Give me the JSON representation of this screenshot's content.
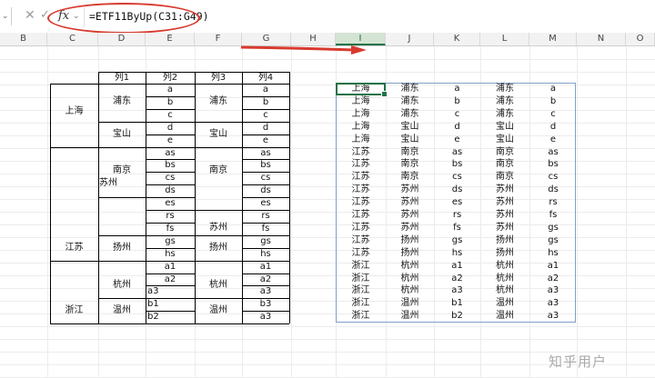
{
  "formula_bar": {
    "function_icon": "fx",
    "formula": "=ETF11ByUp(C31:G49)"
  },
  "columns": [
    "B",
    "C",
    "D",
    "E",
    "F",
    "G",
    "H",
    "I",
    "J",
    "K",
    "L",
    "M",
    "N",
    "O"
  ],
  "selected_column": "I",
  "source": {
    "headers": [
      "列1",
      "列2",
      "列3",
      "列4"
    ],
    "col_c": [
      "上海",
      "江苏",
      "浙江"
    ],
    "col_d": [
      "浦东",
      "宝山",
      "南京",
      "苏州",
      "扬州",
      "杭州",
      "温州"
    ],
    "col_e": [
      "a",
      "b",
      "c",
      "d",
      "e",
      "as",
      "bs",
      "cs",
      "ds",
      "es",
      "rs",
      "fs",
      "gs",
      "hs",
      "a1",
      "a2",
      "a3",
      "b1",
      "b2"
    ],
    "col_f": [
      "浦东",
      "宝山",
      "南京",
      "苏州",
      "扬州",
      "杭州",
      "温州"
    ],
    "col_g": [
      "a",
      "b",
      "c",
      "d",
      "e",
      "as",
      "bs",
      "cs",
      "ds",
      "es",
      "rs",
      "fs",
      "gs",
      "hs",
      "a1",
      "a2",
      "a3",
      "b3",
      "a3"
    ]
  },
  "result": [
    [
      "上海",
      "浦东",
      "a",
      "浦东",
      "a"
    ],
    [
      "上海",
      "浦东",
      "b",
      "浦东",
      "b"
    ],
    [
      "上海",
      "浦东",
      "c",
      "浦东",
      "c"
    ],
    [
      "上海",
      "宝山",
      "d",
      "宝山",
      "d"
    ],
    [
      "上海",
      "宝山",
      "e",
      "宝山",
      "e"
    ],
    [
      "江苏",
      "南京",
      "as",
      "南京",
      "as"
    ],
    [
      "江苏",
      "南京",
      "bs",
      "南京",
      "bs"
    ],
    [
      "江苏",
      "南京",
      "cs",
      "南京",
      "cs"
    ],
    [
      "江苏",
      "苏州",
      "ds",
      "苏州",
      "ds"
    ],
    [
      "江苏",
      "苏州",
      "es",
      "苏州",
      "rs"
    ],
    [
      "江苏",
      "苏州",
      "rs",
      "苏州",
      "fs"
    ],
    [
      "江苏",
      "苏州",
      "fs",
      "苏州",
      "gs"
    ],
    [
      "江苏",
      "扬州",
      "gs",
      "扬州",
      "gs"
    ],
    [
      "江苏",
      "扬州",
      "hs",
      "扬州",
      "hs"
    ],
    [
      "浙江",
      "杭州",
      "a1",
      "杭州",
      "a1"
    ],
    [
      "浙江",
      "杭州",
      "a2",
      "杭州",
      "a2"
    ],
    [
      "浙江",
      "杭州",
      "a3",
      "杭州",
      "a3"
    ],
    [
      "浙江",
      "温州",
      "b1",
      "温州",
      "a3"
    ],
    [
      "浙江",
      "温州",
      "b2",
      "温州",
      "a3"
    ]
  ],
  "watermark": "知乎用户",
  "colors": {
    "accent": "#217346",
    "annotation": "#d83a2e",
    "selection_border": "#7f9fc8"
  }
}
